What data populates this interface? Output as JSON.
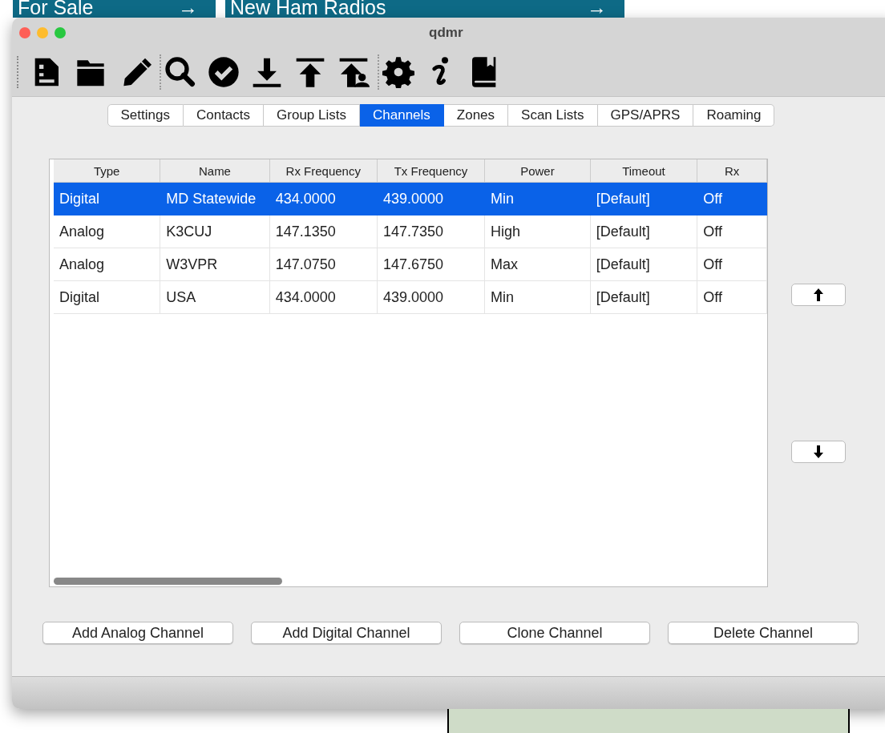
{
  "background_page": {
    "banners": [
      {
        "label": "For Sale",
        "arrow": "→"
      },
      {
        "label": "New Ham Radios",
        "arrow": "→"
      }
    ]
  },
  "window": {
    "title": "qdmr"
  },
  "tabs": [
    {
      "label": "Settings",
      "selected": false
    },
    {
      "label": "Contacts",
      "selected": false
    },
    {
      "label": "Group Lists",
      "selected": false
    },
    {
      "label": "Channels",
      "selected": true
    },
    {
      "label": "Zones",
      "selected": false
    },
    {
      "label": "Scan Lists",
      "selected": false
    },
    {
      "label": "GPS/APRS",
      "selected": false
    },
    {
      "label": "Roaming",
      "selected": false
    }
  ],
  "table": {
    "columns": [
      "Type",
      "Name",
      "Rx Frequency",
      "Tx Frequency",
      "Power",
      "Timeout",
      "Rx"
    ],
    "rows": [
      {
        "cells": [
          "Digital",
          "MD Statewide",
          "434.0000",
          "439.0000",
          "Min",
          "[Default]",
          "Off"
        ],
        "selected": true
      },
      {
        "cells": [
          "Analog",
          "K3CUJ",
          "147.1350",
          "147.7350",
          "High",
          "[Default]",
          "Off"
        ],
        "selected": false
      },
      {
        "cells": [
          "Analog",
          "W3VPR",
          "147.0750",
          "147.6750",
          "Max",
          "[Default]",
          "Off"
        ],
        "selected": false
      },
      {
        "cells": [
          "Digital",
          "USA",
          "434.0000",
          "439.0000",
          "Min",
          "[Default]",
          "Off"
        ],
        "selected": false
      }
    ]
  },
  "buttons": [
    "Add Analog Channel",
    "Add Digital Channel",
    "Clone Channel",
    "Delete Channel"
  ]
}
